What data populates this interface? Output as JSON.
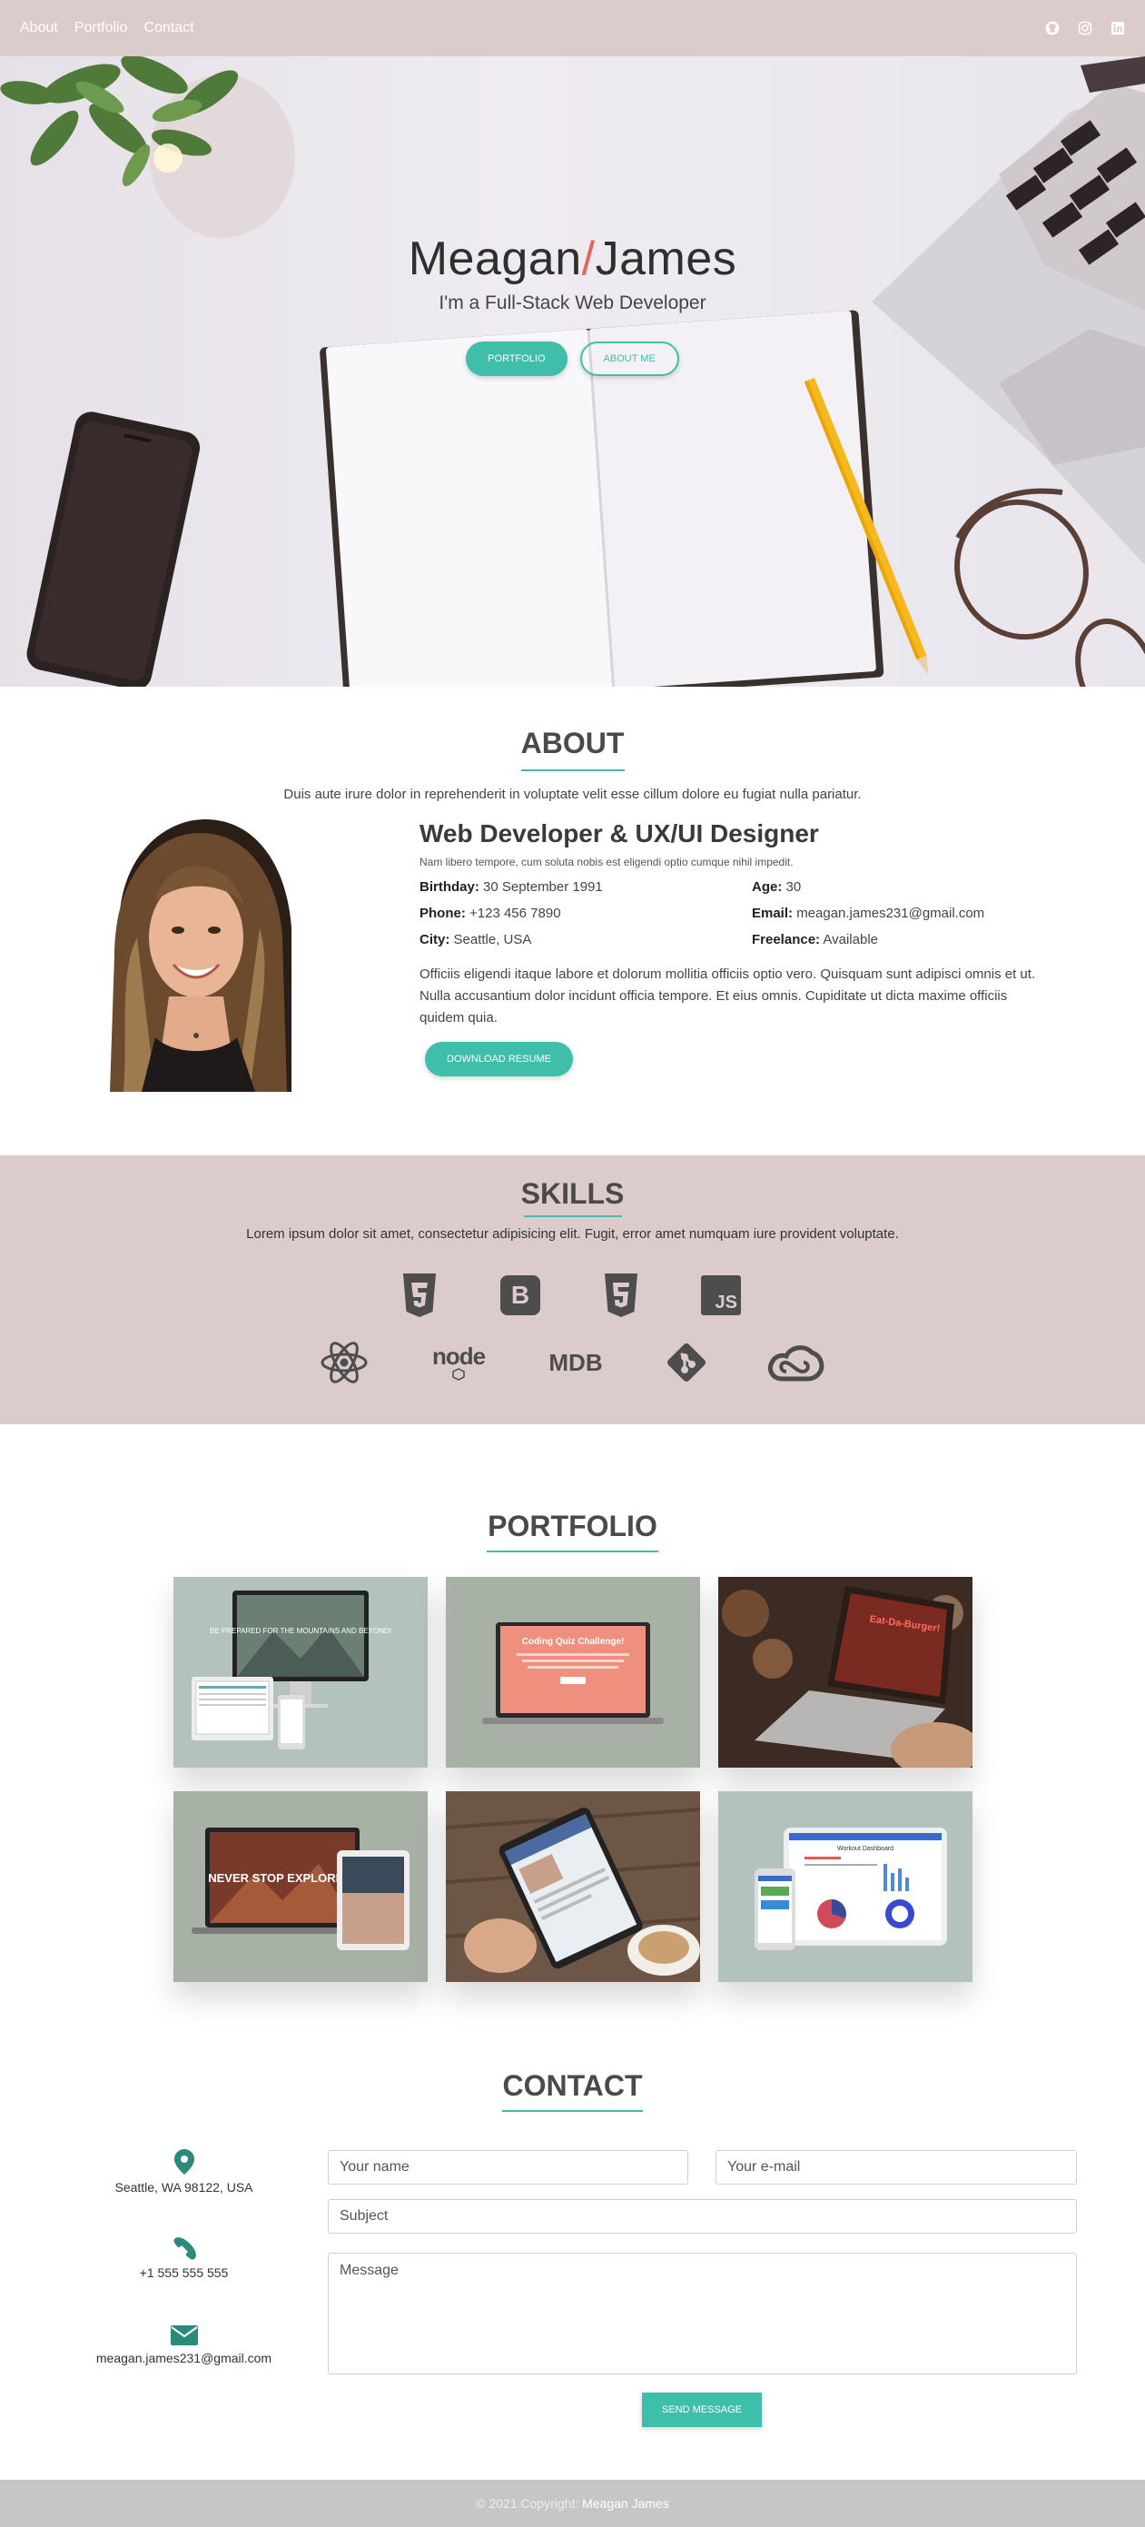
{
  "nav": {
    "links": [
      "About",
      "Portfolio",
      "Contact"
    ],
    "social_icons": [
      "github-icon",
      "instagram-icon",
      "linkedin-icon"
    ]
  },
  "hero": {
    "first_name": "Meagan",
    "slash": "/",
    "last_name": "James",
    "subtitle": "I'm a Full-Stack Web Developer",
    "btn_portfolio": "PORTFOLIO",
    "btn_about": "ABOUT ME"
  },
  "about": {
    "title": "ABOUT",
    "lead": "Duis aute irure dolor in reprehenderit in voluptate velit esse cillum dolore eu fugiat nulla pariatur.",
    "role": "Web Developer & UX/UI Designer",
    "small": "Nam libero tempore, cum soluta nobis est eligendi optio cumque nihil impedit.",
    "facts": [
      {
        "label": "Birthday:",
        "value": "30 September 1991"
      },
      {
        "label": "Age:",
        "value": "30"
      },
      {
        "label": "Phone:",
        "value": "+123 456 7890"
      },
      {
        "label": "Email:",
        "value": "meagan.james231@gmail.com"
      },
      {
        "label": "City:",
        "value": "Seattle, USA"
      },
      {
        "label": "Freelance:",
        "value": "Available"
      }
    ],
    "paragraph": "Officiis eligendi itaque labore et dolorum mollitia officiis optio vero. Quisquam sunt adipisci omnis et ut. Nulla accusantium dolor incidunt officia tempore. Et eius omnis. Cupiditate ut dicta maxime officiis quidem quia.",
    "download": "DOWNLOAD RESUME"
  },
  "skills": {
    "title": "SKILLS",
    "lead": "Lorem ipsum dolor sit amet, consectetur adipisicing elit. Fugit, error amet numquam iure provident voluptate.",
    "icons": [
      "css3-icon",
      "bootstrap-icon",
      "html5-icon",
      "javascript-icon",
      "react-icon",
      "node-icon",
      "mdb-icon",
      "git-icon",
      "creative-cloud-icon"
    ],
    "node_label": "node",
    "mdb_label": "MDB",
    "js_label": "JS",
    "b_label": "B"
  },
  "portfolio": {
    "title": "PORTFOLIO",
    "items": [
      {
        "name": "portfolio-item-mountains",
        "caption": "BE PREPARED FOR THE MOUNTAINS AND BEYOND!"
      },
      {
        "name": "portfolio-item-coding-quiz",
        "caption": "Coding Quiz Challenge!"
      },
      {
        "name": "portfolio-item-eat-da-burger",
        "caption": "Eat-Da-Burger!"
      },
      {
        "name": "portfolio-item-never-stop-exploring",
        "caption": "NEVER STOP EXPLORING"
      },
      {
        "name": "portfolio-item-tablet-app",
        "caption": ""
      },
      {
        "name": "portfolio-item-workout-dashboard",
        "caption": "Workout Dashboard"
      }
    ]
  },
  "contact": {
    "title": "CONTACT",
    "address": "Seattle, WA 98122, USA",
    "phone": "+1 555 555 555",
    "email": "meagan.james231@gmail.com",
    "name_placeholder": "Your name",
    "email_placeholder": "Your e-mail",
    "subject_placeholder": "Subject",
    "message_placeholder": "Message",
    "send": "SEND MESSAGE"
  },
  "footer": {
    "copyright": "© 2021 Copyright:",
    "name": "Meagan James"
  },
  "colors": {
    "accent": "#3fbeaa",
    "nav": "#dccbcb",
    "slash": "#e2665c",
    "footer": "#c6c6c6"
  }
}
